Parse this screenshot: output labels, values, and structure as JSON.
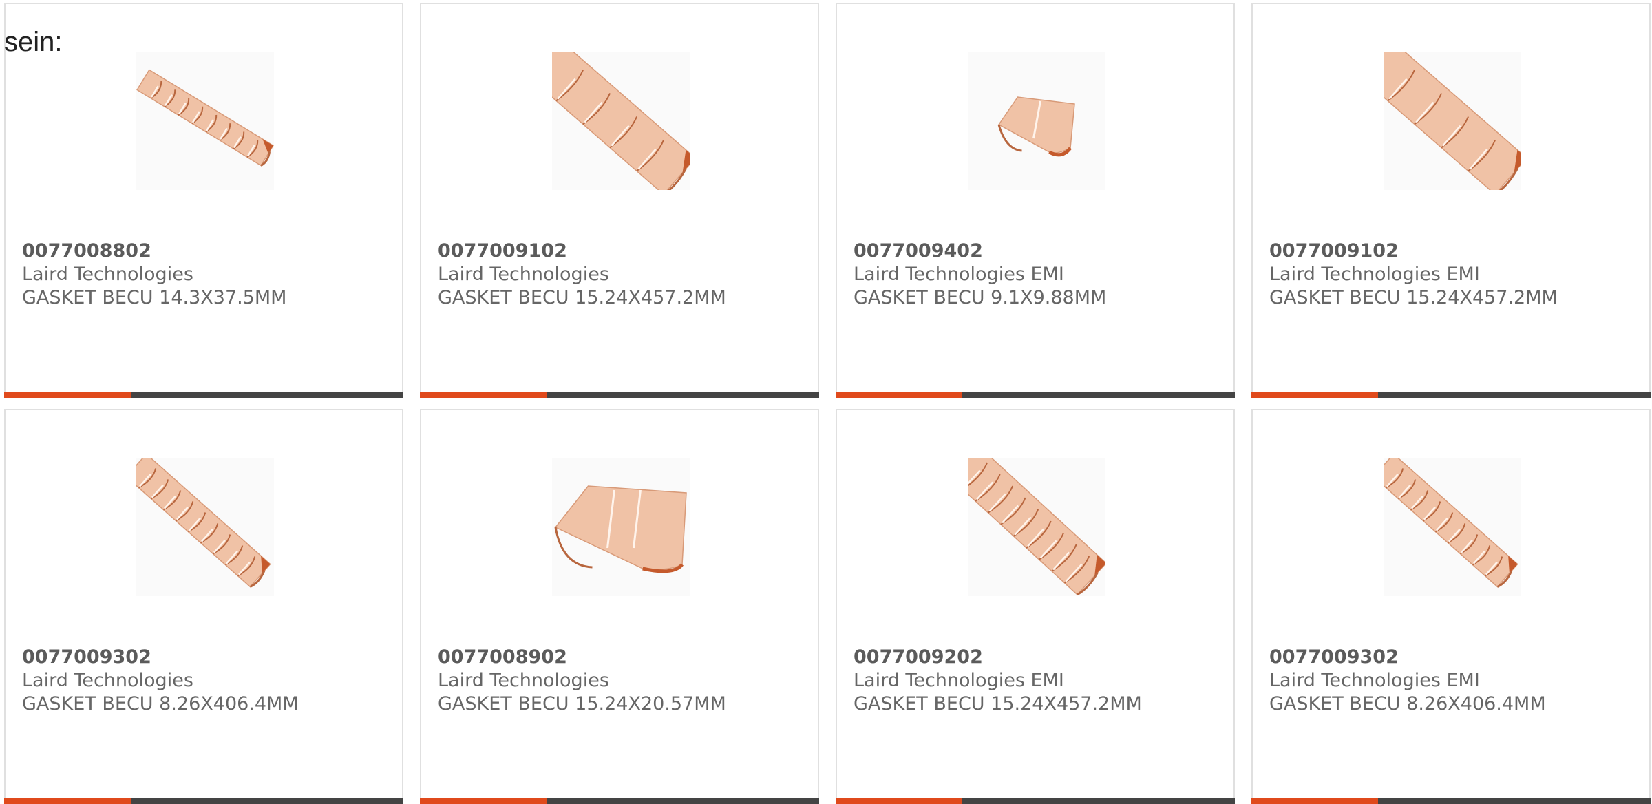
{
  "intro_text": "sein:",
  "colors": {
    "accent": "#e04a1c",
    "bar": "#444444",
    "copper_light": "#f0c2a6",
    "copper_mid": "#d89a78",
    "copper_dark": "#b8663e",
    "copper_inner": "#c55a2c"
  },
  "products": [
    {
      "part_number": "0077008802",
      "manufacturer": "Laird Technologies",
      "description": "GASKET BECU 14.3X37.5MM",
      "image_icon": "copper-gasket-strip-icon",
      "shape": "strip-small"
    },
    {
      "part_number": "0077009102",
      "manufacturer": "Laird Technologies",
      "description": "GASKET BECU 15.24X457.2MM",
      "image_icon": "copper-gasket-strip-icon",
      "shape": "strip-large"
    },
    {
      "part_number": "0077009402",
      "manufacturer": "Laird Technologies EMI",
      "description": "GASKET BECU 9.1X9.88MM",
      "image_icon": "copper-gasket-clip-icon",
      "shape": "clip-small"
    },
    {
      "part_number": "0077009102",
      "manufacturer": "Laird Technologies EMI",
      "description": "GASKET BECU 15.24X457.2MM",
      "image_icon": "copper-gasket-strip-icon",
      "shape": "strip-large"
    },
    {
      "part_number": "0077009302",
      "manufacturer": "Laird Technologies",
      "description": "GASKET BECU 8.26X406.4MM",
      "image_icon": "copper-gasket-strip-icon",
      "shape": "strip-slotted"
    },
    {
      "part_number": "0077008902",
      "manufacturer": "Laird Technologies",
      "description": "GASKET BECU 15.24X20.57MM",
      "image_icon": "copper-gasket-clip-icon",
      "shape": "clip-large"
    },
    {
      "part_number": "0077009202",
      "manufacturer": "Laird Technologies EMI",
      "description": "GASKET BECU 15.24X457.2MM",
      "image_icon": "copper-gasket-strip-icon",
      "shape": "strip-dense"
    },
    {
      "part_number": "0077009302",
      "manufacturer": "Laird Technologies EMI",
      "description": "GASKET BECU 8.26X406.4MM",
      "image_icon": "copper-gasket-strip-icon",
      "shape": "strip-slotted"
    }
  ]
}
